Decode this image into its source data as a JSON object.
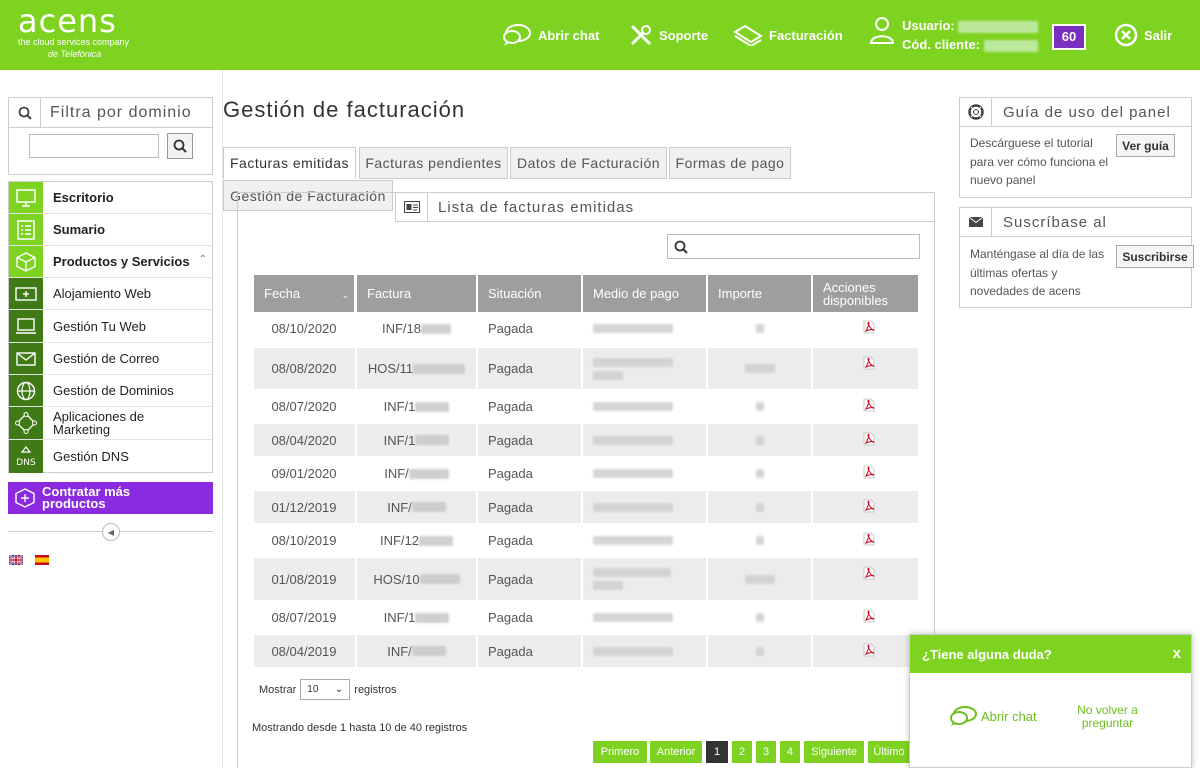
{
  "brand": {
    "name": "acens",
    "tagline": "the cloud services company",
    "by": "de Telefónica",
    "color": "#7ed321",
    "accent": "#7b2fbe"
  },
  "header": {
    "chat_label": "Abrir chat",
    "support_label": "Soporte",
    "billing_label": "Facturación",
    "user_label": "Usuario:",
    "client_label": "Cód. cliente:",
    "badge": "60",
    "logout_label": "Salir"
  },
  "filter": {
    "title": "Filtra por dominio",
    "placeholder": ""
  },
  "menu": {
    "items": [
      {
        "label": "Escritorio",
        "icon": "monitor-icon"
      },
      {
        "label": "Sumario",
        "icon": "list-icon"
      },
      {
        "label": "Productos y Servicios",
        "icon": "cube-icon"
      },
      {
        "label": "Alojamiento Web",
        "icon": "plus-box-icon"
      },
      {
        "label": "Gestión Tu Web",
        "icon": "laptop-icon"
      },
      {
        "label": "Gestión de Correo",
        "icon": "envelope-icon"
      },
      {
        "label": "Gestión de Dominios",
        "icon": "globe-icon"
      },
      {
        "label": "Aplicaciones de Marketing",
        "icon": "network-icon"
      },
      {
        "label": "Gestión DNS",
        "icon": "dns-icon"
      }
    ],
    "contratar": "Contratar más productos"
  },
  "page": {
    "title": "Gestión de facturación"
  },
  "tabs": [
    "Facturas emitidas",
    "Facturas pendientes",
    "Datos de Facturación",
    "Formas de pago",
    "Gestión de Facturación"
  ],
  "panel": {
    "title": "Lista de facturas emitidas",
    "search_placeholder": ""
  },
  "table": {
    "headers": [
      "Fecha",
      "Factura",
      "Situación",
      "Medio de pago",
      "Importe",
      "Acciones disponibles"
    ],
    "rows": [
      {
        "fecha": "08/10/2020",
        "factura": "INF/18",
        "situacion": "Pagada"
      },
      {
        "fecha": "08/08/2020",
        "factura": "HOS/11",
        "situacion": "Pagada"
      },
      {
        "fecha": "08/07/2020",
        "factura": "INF/1",
        "situacion": "Pagada"
      },
      {
        "fecha": "08/04/2020",
        "factura": "INF/1",
        "situacion": "Pagada"
      },
      {
        "fecha": "09/01/2020",
        "factura": "INF/",
        "situacion": "Pagada"
      },
      {
        "fecha": "01/12/2019",
        "factura": "INF/",
        "situacion": "Pagada"
      },
      {
        "fecha": "08/10/2019",
        "factura": "INF/12",
        "situacion": "Pagada"
      },
      {
        "fecha": "01/08/2019",
        "factura": "HOS/10",
        "situacion": "Pagada"
      },
      {
        "fecha": "08/07/2019",
        "factura": "INF/1",
        "situacion": "Pagada"
      },
      {
        "fecha": "08/04/2019",
        "factura": "INF/",
        "situacion": "Pagada"
      }
    ]
  },
  "length": {
    "prefix": "Mostrar",
    "value": "10",
    "suffix": "registros"
  },
  "info": "Mostrando desde 1 hasta 10 de 40 registros",
  "pagination": [
    "Primero",
    "Anterior",
    "1",
    "2",
    "3",
    "4",
    "Siguiente",
    "Último"
  ],
  "guide": {
    "title": "Guía de uso del panel",
    "text": "Descárguese el tutorial para ver cómo funciona el nuevo panel",
    "button": "Ver guía"
  },
  "subscribe": {
    "title": "Suscríbase al",
    "text": "Manténgase al día de las últimas ofertas y novedades de acens",
    "button": "Suscribirse"
  },
  "chat": {
    "title": "¿Tiene alguna duda?",
    "close": "x",
    "open": "Abrir chat",
    "no": "No volver a preguntar"
  }
}
